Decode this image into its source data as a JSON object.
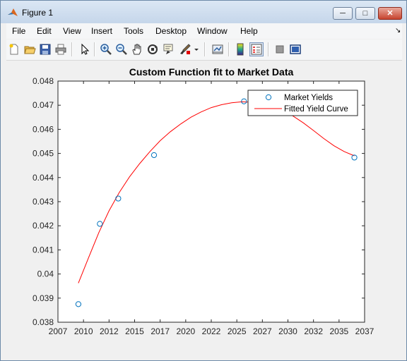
{
  "window": {
    "title": "Figure 1",
    "min_label": "─",
    "max_label": "□",
    "close_label": "✕"
  },
  "menu": [
    "File",
    "Edit",
    "View",
    "Insert",
    "Tools",
    "Desktop",
    "Window",
    "Help"
  ],
  "toolbar_icons": [
    "new-figure-icon",
    "open-file-icon",
    "save-icon",
    "print-icon",
    "edit-plot-arrow-icon",
    "zoom-in-icon",
    "zoom-out-icon",
    "pan-hand-icon",
    "rotate-3d-icon",
    "data-cursor-icon",
    "brush-icon",
    "brush-dropdown-icon",
    "link-plot-icon",
    "insert-colorbar-icon",
    "insert-legend-icon",
    "hide-plot-tools-icon",
    "show-plot-tools-icon"
  ],
  "colors": {
    "marker": "#0072bd",
    "fit_line": "#ff0000"
  },
  "chart_data": {
    "type": "line",
    "title": "Custom Function fit to Market Data",
    "xlabel": "",
    "ylabel": "",
    "xlim": [
      2007,
      2037
    ],
    "ylim": [
      0.038,
      0.048
    ],
    "xticks": [
      "2007",
      "2010",
      "2012",
      "2015",
      "2017",
      "2020",
      "2022",
      "2025",
      "2027",
      "2030",
      "2032",
      "2035",
      "2037"
    ],
    "yticks": [
      "0.038",
      "0.039",
      "0.04",
      "0.041",
      "0.042",
      "0.043",
      "0.044",
      "0.045",
      "0.046",
      "0.047",
      "0.048"
    ],
    "grid": false,
    "legend_position": "top-right",
    "series": [
      {
        "name": "Market Yields",
        "style": "marker-circle",
        "x": [
          2009.0,
          2011.1,
          2012.9,
          2016.4,
          2025.2,
          2036.0
        ],
        "y": [
          0.03875,
          0.04208,
          0.04313,
          0.04493,
          0.04716,
          0.04483
        ]
      },
      {
        "name": "Fitted Yield Curve",
        "style": "line",
        "x": [
          2009.0,
          2010.0,
          2011.0,
          2012.0,
          2013.0,
          2014.0,
          2015.0,
          2016.0,
          2017.0,
          2018.0,
          2019.0,
          2020.0,
          2021.0,
          2022.0,
          2023.0,
          2024.0,
          2025.0,
          2026.0,
          2027.0,
          2028.0,
          2029.0,
          2030.0,
          2031.0,
          2032.0,
          2033.0,
          2034.0,
          2035.0,
          2036.0
        ],
        "y": [
          0.03962,
          0.04068,
          0.04172,
          0.04262,
          0.04338,
          0.04403,
          0.04458,
          0.04508,
          0.04553,
          0.0459,
          0.04622,
          0.0465,
          0.04672,
          0.0469,
          0.04702,
          0.0471,
          0.04714,
          0.04712,
          0.04706,
          0.04694,
          0.04677,
          0.04655,
          0.04627,
          0.04595,
          0.04562,
          0.04532,
          0.04508,
          0.0449
        ]
      }
    ]
  }
}
